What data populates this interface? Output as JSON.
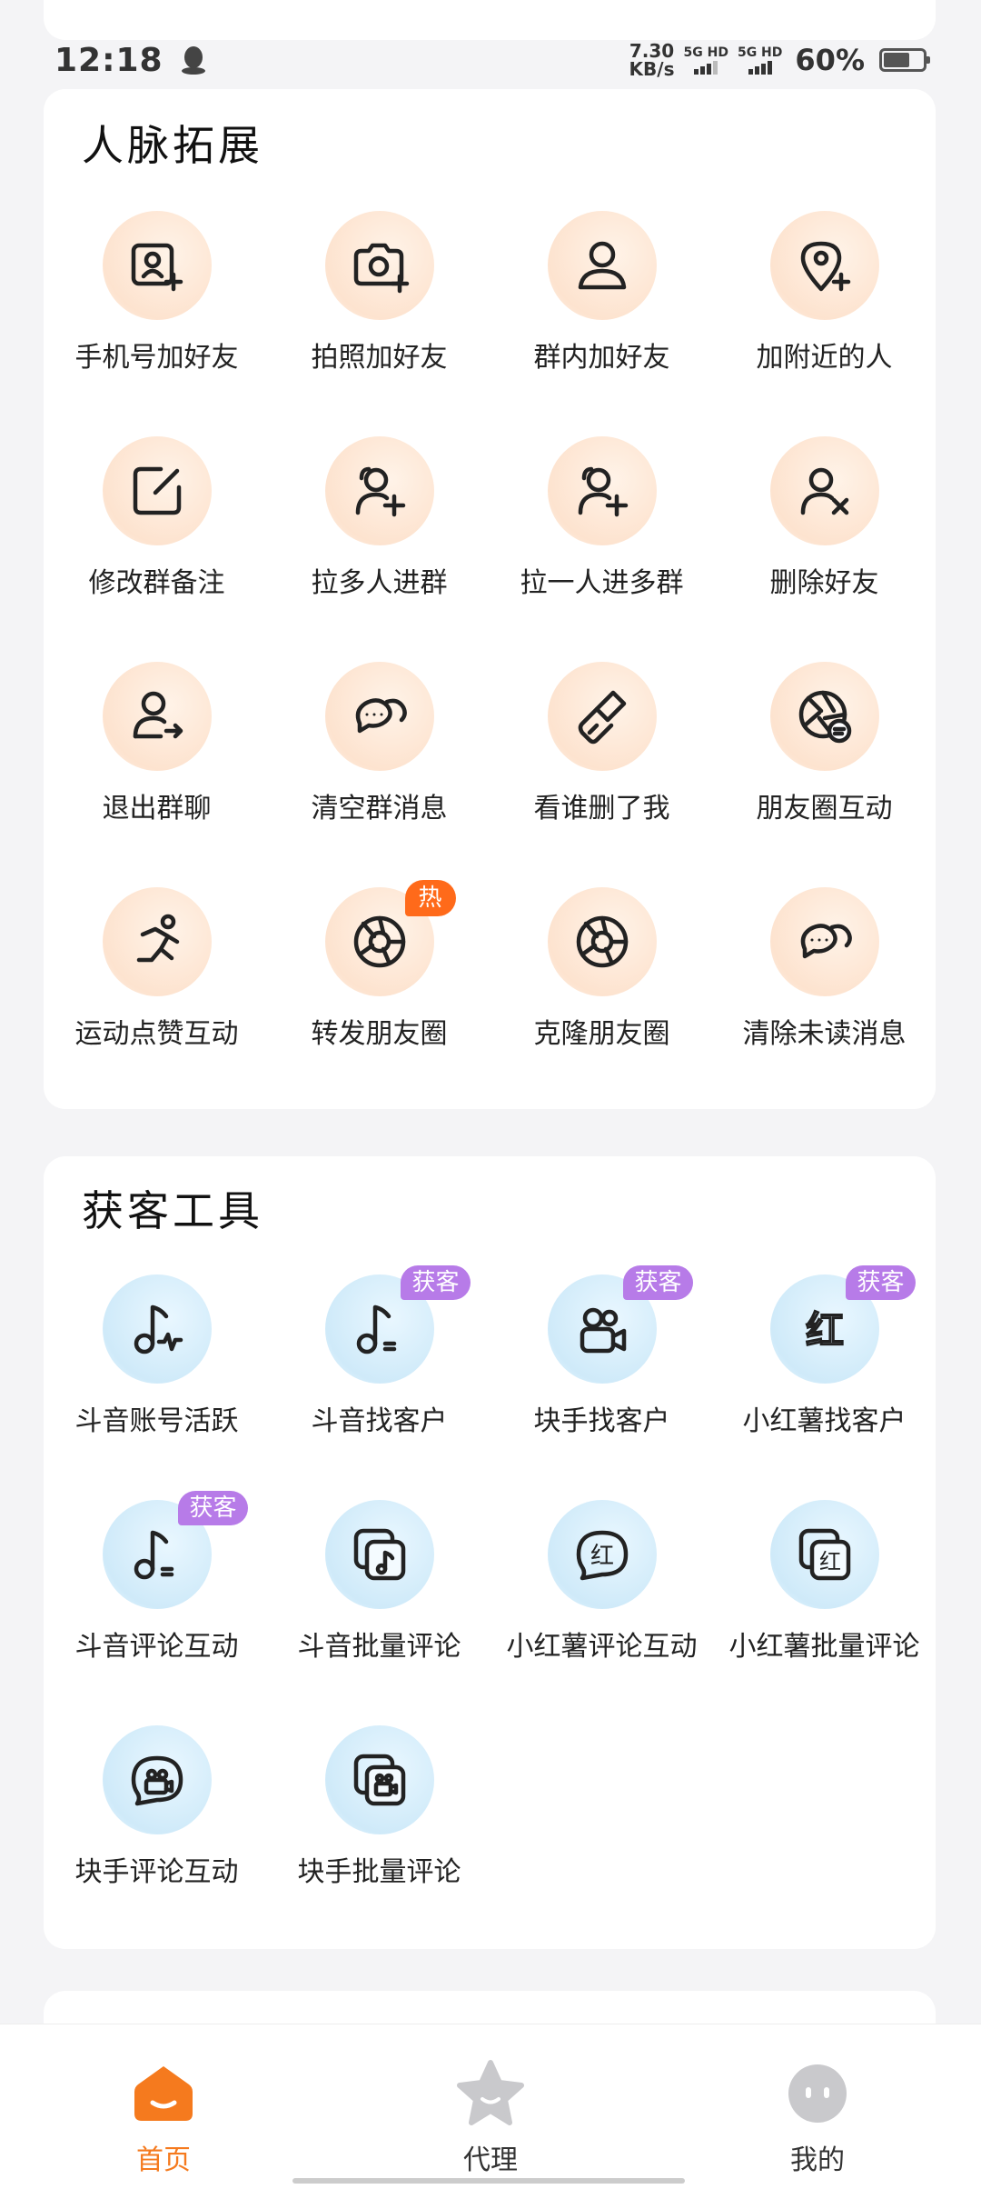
{
  "status_bar": {
    "time": "12:18",
    "net_speed_value": "7.30",
    "net_speed_unit": "KB/s",
    "sim1": "5G HD",
    "sim2": "5G HD",
    "battery": "60%"
  },
  "section1": {
    "title": "人脉拓展",
    "items": [
      {
        "label": "手机号加好友",
        "icon": "contact-card-add-icon"
      },
      {
        "label": "拍照加好友",
        "icon": "camera-add-icon"
      },
      {
        "label": "群内加好友",
        "icon": "person-icon"
      },
      {
        "label": "加附近的人",
        "icon": "location-add-icon"
      },
      {
        "label": "修改群备注",
        "icon": "edit-icon"
      },
      {
        "label": "拉多人进群",
        "icon": "user-add-icon"
      },
      {
        "label": "拉一人进多群",
        "icon": "user-add-icon"
      },
      {
        "label": "删除好友",
        "icon": "user-remove-icon"
      },
      {
        "label": "退出群聊",
        "icon": "user-exit-icon"
      },
      {
        "label": "清空群消息",
        "icon": "chat-bubbles-icon"
      },
      {
        "label": "看谁删了我",
        "icon": "brush-icon"
      },
      {
        "label": "朋友圈互动",
        "icon": "aperture-chat-icon"
      },
      {
        "label": "运动点赞互动",
        "icon": "running-icon"
      },
      {
        "label": "转发朋友圈",
        "icon": "aperture-icon",
        "badge": "热"
      },
      {
        "label": "克隆朋友圈",
        "icon": "aperture-icon"
      },
      {
        "label": "清除未读消息",
        "icon": "chat-bubbles-icon"
      }
    ]
  },
  "section2": {
    "title": "获客工具",
    "items": [
      {
        "label": "斗音账号活跃",
        "icon": "music-pulse-icon"
      },
      {
        "label": "斗音找客户",
        "icon": "music-note-icon",
        "badge": "获客"
      },
      {
        "label": "块手找客户",
        "icon": "video-camera-icon",
        "badge": "获客"
      },
      {
        "label": "小红薯找客户",
        "icon": "red-character-icon",
        "badge": "获客",
        "glyph": "红"
      },
      {
        "label": "斗音评论互动",
        "icon": "music-note-icon",
        "badge": "获客"
      },
      {
        "label": "斗音批量评论",
        "icon": "stacked-music-icon"
      },
      {
        "label": "小红薯评论互动",
        "icon": "red-bubble-icon",
        "glyph": "红"
      },
      {
        "label": "小红薯批量评论",
        "icon": "stacked-red-icon",
        "glyph": "红"
      },
      {
        "label": "块手评论互动",
        "icon": "video-bubble-icon"
      },
      {
        "label": "块手批量评论",
        "icon": "stacked-video-icon"
      }
    ]
  },
  "bottom_nav": [
    {
      "label": "首页",
      "icon": "home-icon",
      "active": true
    },
    {
      "label": "代理",
      "icon": "star-icon",
      "active": false
    },
    {
      "label": "我的",
      "icon": "profile-face-icon",
      "active": false
    }
  ],
  "colors": {
    "accent": "#f57a1e",
    "badge": "#b77be8",
    "hot": "#ff6a1a"
  }
}
